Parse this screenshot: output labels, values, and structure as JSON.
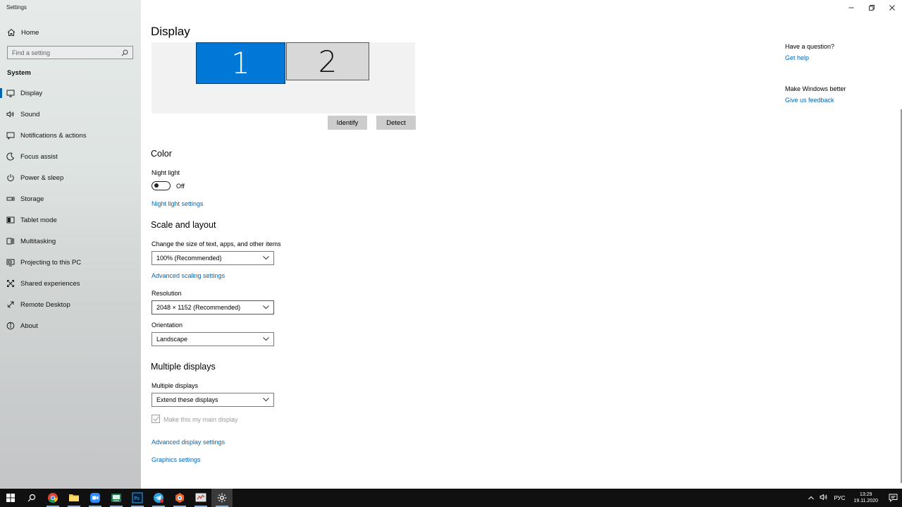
{
  "window": {
    "title": "Settings"
  },
  "sidebar": {
    "home": "Home",
    "search_placeholder": "Find a setting",
    "section": "System",
    "items": [
      {
        "label": "Display",
        "icon": "display-icon"
      },
      {
        "label": "Sound",
        "icon": "sound-icon"
      },
      {
        "label": "Notifications & actions",
        "icon": "notifications-icon"
      },
      {
        "label": "Focus assist",
        "icon": "focus-assist-icon"
      },
      {
        "label": "Power & sleep",
        "icon": "power-icon"
      },
      {
        "label": "Storage",
        "icon": "storage-icon"
      },
      {
        "label": "Tablet mode",
        "icon": "tablet-icon"
      },
      {
        "label": "Multitasking",
        "icon": "multitasking-icon"
      },
      {
        "label": "Projecting to this PC",
        "icon": "projecting-icon"
      },
      {
        "label": "Shared experiences",
        "icon": "shared-icon"
      },
      {
        "label": "Remote Desktop",
        "icon": "remote-desktop-icon"
      },
      {
        "label": "About",
        "icon": "about-icon"
      }
    ]
  },
  "main": {
    "title": "Display",
    "monitors": [
      "1",
      "2"
    ],
    "identify": "Identify",
    "detect": "Detect",
    "color": {
      "heading": "Color",
      "night_light_label": "Night light",
      "night_light_state": "Off",
      "night_light_link": "Night light settings"
    },
    "scale": {
      "heading": "Scale and layout",
      "size_label": "Change the size of text, apps, and other items",
      "size_value": "100% (Recommended)",
      "advanced_link": "Advanced scaling settings",
      "resolution_label": "Resolution",
      "resolution_value": "2048 × 1152 (Recommended)",
      "orientation_label": "Orientation",
      "orientation_value": "Landscape"
    },
    "multiple": {
      "heading": "Multiple displays",
      "label": "Multiple displays",
      "value": "Extend these displays",
      "main_display": "Make this my main display",
      "advanced_link": "Advanced display settings",
      "graphics_link": "Graphics settings"
    }
  },
  "aside": {
    "question": "Have a question?",
    "help": "Get help",
    "better": "Make Windows better",
    "feedback": "Give us feedback"
  },
  "taskbar": {
    "lang": "РУС",
    "time": "13:29",
    "date": "19.11.2020",
    "apps": [
      "start-icon",
      "search-icon",
      "chrome-icon",
      "file-explorer-icon",
      "zoom-icon",
      "terminal-icon",
      "photoshop-icon",
      "telegram-icon",
      "app-icon",
      "task-manager-icon",
      "settings-icon"
    ]
  },
  "colors": {
    "accent": "#0078d7",
    "link": "#0067b8",
    "taskbar": "#101010"
  }
}
